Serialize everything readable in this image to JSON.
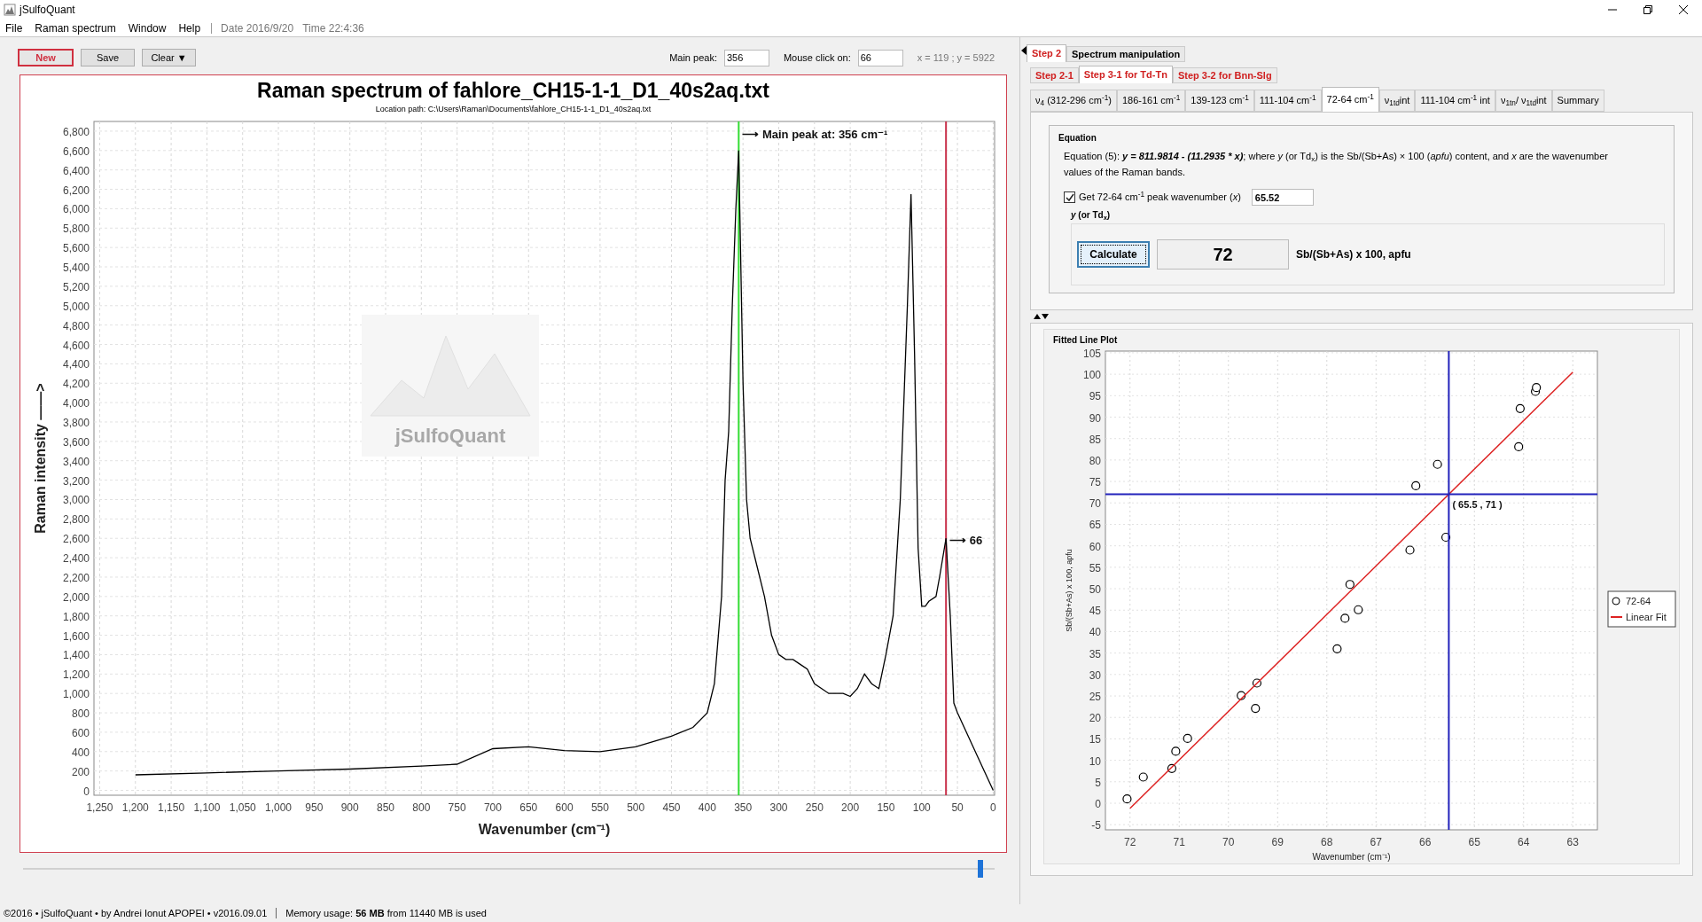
{
  "window": {
    "title": "jSulfoQuant"
  },
  "menu": [
    "File",
    "Raman spectrum",
    "Window",
    "Help"
  ],
  "menu_info": [
    "Date 2016/9/20",
    "Time 22:4:36"
  ],
  "toolbar": {
    "buttons": [
      {
        "label": "New",
        "kind": "primary"
      },
      {
        "label": "Save",
        "kind": "normal"
      },
      {
        "label": "Clear ▼",
        "kind": "normal"
      }
    ],
    "fields": [
      {
        "label": "Main peak:",
        "value": "356"
      },
      {
        "label": "Mouse click on:",
        "value": "66"
      }
    ],
    "coords": "x = 119 ; y = 5922"
  },
  "spectrum": {
    "title": "Raman spectrum of fahlore_CH15-1-1_D1_40s2aq.txt",
    "location": "Location path: C:\\Users\\Raman\\Documents\\fahlore_CH15-1-1_D1_40s2aq.txt",
    "logo_text": "jSulfoQuant",
    "chart_data": {
      "type": "line",
      "xlabel": "Wavenumber (cm⁻¹)",
      "ylabel": "Raman intensity ——>",
      "xlim": [
        1258,
        -2
      ],
      "ylim": [
        -50,
        6900
      ],
      "xticks": [
        {
          "value": 1250,
          "label": "1,250"
        },
        {
          "value": 1200,
          "label": "1,200"
        },
        {
          "value": 1150,
          "label": "1,150"
        },
        {
          "value": 1100,
          "label": "1,100"
        },
        {
          "value": 1050,
          "label": "1,050"
        },
        {
          "value": 1000,
          "label": "1,000"
        },
        950,
        900,
        850,
        800,
        750,
        700,
        650,
        600,
        550,
        500,
        450,
        400,
        350,
        300,
        250,
        200,
        150,
        100,
        50,
        0
      ],
      "yticks": [
        0,
        200,
        400,
        600,
        800,
        {
          "value": 1000,
          "label": "1,000"
        },
        {
          "value": 1200,
          "label": "1,200"
        },
        {
          "value": 1400,
          "label": "1,400"
        },
        {
          "value": 1600,
          "label": "1,600"
        },
        {
          "value": 1800,
          "label": "1,800"
        },
        {
          "value": 2000,
          "label": "2,000"
        },
        {
          "value": 2200,
          "label": "2,200"
        },
        {
          "value": 2400,
          "label": "2,400"
        },
        {
          "value": 2600,
          "label": "2,600"
        },
        {
          "value": 2800,
          "label": "2,800"
        },
        {
          "value": 3000,
          "label": "3,000"
        },
        {
          "value": 3200,
          "label": "3,200"
        },
        {
          "value": 3400,
          "label": "3,400"
        },
        {
          "value": 3600,
          "label": "3,600"
        },
        {
          "value": 3800,
          "label": "3,800"
        },
        {
          "value": 4000,
          "label": "4,000"
        },
        {
          "value": 4200,
          "label": "4,200"
        },
        {
          "value": 4400,
          "label": "4,400"
        },
        {
          "value": 4600,
          "label": "4,600"
        },
        {
          "value": 4800,
          "label": "4,800"
        },
        {
          "value": 5000,
          "label": "5,000"
        },
        {
          "value": 5200,
          "label": "5,200"
        },
        {
          "value": 5400,
          "label": "5,400"
        },
        {
          "value": 5600,
          "label": "5,600"
        },
        {
          "value": 5800,
          "label": "5,800"
        },
        {
          "value": 6000,
          "label": "6,000"
        },
        {
          "value": 6200,
          "label": "6,200"
        },
        {
          "value": 6400,
          "label": "6,400"
        },
        {
          "value": 6600,
          "label": "6,600"
        },
        {
          "value": 6800,
          "label": "6,800"
        }
      ],
      "x": [
        1200,
        1100,
        1000,
        900,
        800,
        750,
        700,
        650,
        600,
        550,
        500,
        450,
        420,
        400,
        390,
        380,
        375,
        370,
        365,
        360,
        356,
        350,
        345,
        340,
        330,
        320,
        310,
        300,
        290,
        280,
        270,
        260,
        250,
        240,
        230,
        220,
        210,
        200,
        190,
        180,
        170,
        160,
        150,
        140,
        130,
        120,
        115,
        110,
        105,
        100,
        95,
        90,
        80,
        75,
        66,
        60,
        55,
        50,
        25,
        0
      ],
      "grid": true,
      "series": [
        {
          "color": "#000000",
          "values": [
            160,
            180,
            200,
            220,
            250,
            270,
            430,
            450,
            410,
            400,
            450,
            560,
            650,
            800,
            1100,
            2000,
            3200,
            3700,
            5000,
            6000,
            6600,
            4200,
            3000,
            2600,
            2300,
            2000,
            1600,
            1400,
            1350,
            1350,
            1300,
            1250,
            1100,
            1050,
            1000,
            1000,
            1000,
            970,
            1050,
            1200,
            1100,
            1050,
            1400,
            1800,
            3000,
            5000,
            6150,
            4500,
            2500,
            1900,
            1900,
            1950,
            2000,
            2200,
            2600,
            1800,
            900,
            800,
            400,
            0
          ]
        }
      ],
      "ref_lines": [
        {
          "axis": "x",
          "value": 356,
          "color": "#33dd33"
        },
        {
          "axis": "x",
          "value": 66,
          "color": "#c8304a"
        }
      ],
      "annotations": [
        "⟶ Main peak at: 356 cm⁻¹",
        "⟶ 66"
      ]
    }
  },
  "slider": {
    "level": 0.985
  },
  "tabs_level1": [
    {
      "label": "Step 2",
      "selected": true
    },
    {
      "label": "Spectrum manipulation",
      "selected": false
    }
  ],
  "tabs_level2": [
    {
      "label": "Step 2-1",
      "selected": false
    },
    {
      "label": "Step 3-1 for Td-Tn",
      "selected": true
    },
    {
      "label": "Step 3-2 for Bnn-Slg",
      "selected": false
    }
  ],
  "tabs_level3": [
    {
      "label": "ν$_{4}$ (312-296 cm$^{-1}$)",
      "selected": false
    },
    {
      "label": "186-161 cm$^{-1}$",
      "selected": false
    },
    {
      "label": "139-123 cm$^{-1}$",
      "selected": false
    },
    {
      "label": "111-104 cm$^{-1}$",
      "selected": false
    },
    {
      "label": "72-64 cm$^{-1}$",
      "selected": true
    },
    {
      "label": "ν$_{1td}$int",
      "selected": false
    },
    {
      "label": "111-104 cm$^{-1}$ int",
      "selected": false
    },
    {
      "label": "ν$_{1tn}$/ ν$_{1td}$int",
      "selected": false
    },
    {
      "label": "Summary",
      "selected": false
    }
  ],
  "equation": {
    "title": "Equation",
    "parts": [
      {
        "text": "Equation (5): ",
        "kind": "plain"
      },
      {
        "text": "y = 811.9814 - (11.2935 * x)",
        "kind": "formula"
      },
      {
        "text": "; where ",
        "kind": "plain"
      },
      {
        "text": "y",
        "kind": "variable"
      },
      {
        "text": " (or Td",
        "kind": "plain"
      },
      {
        "text": "x",
        "kind": "subscript"
      },
      {
        "text": ") is the Sb/(Sb+As) × 100 (",
        "kind": "plain"
      },
      {
        "text": "apfu",
        "kind": "variable"
      },
      {
        "text": ") content, and ",
        "kind": "plain"
      },
      {
        "text": "x",
        "kind": "variable"
      },
      {
        "text": " are the wavenumber values of the Raman bands.",
        "kind": "plain"
      }
    ],
    "checkbox": {
      "label": "Get 72-64 cm$^{-1}$ peak wavenumber (*x*)",
      "checked": true
    },
    "x_value": "65.52",
    "result_group": "*y* (or Td$_{x}$)",
    "button": "Calculate",
    "result": "72",
    "unit": "Sb/(Sb+As) x 100, apfu"
  },
  "fitted_plot": {
    "title": "Fitted Line Plot",
    "chart_data": {
      "type": "scatter",
      "xlabel": "Wavenumber (cm⁻¹)",
      "ylabel": "Sb/(Sb+As) x 100, apfu",
      "xlim": [
        72.5,
        62.5
      ],
      "ylim": [
        -6.2,
        105.4
      ],
      "xticks": [
        72,
        71,
        70,
        69,
        68,
        67,
        66,
        65,
        64,
        63
      ],
      "yticks": [
        -5,
        0,
        5,
        10,
        15,
        20,
        25,
        30,
        35,
        40,
        45,
        50,
        55,
        60,
        65,
        70,
        75,
        80,
        85,
        90,
        95,
        100,
        105
      ],
      "grid": true,
      "series": [
        {
          "name": "72-64",
          "type": "scatter",
          "color": "#000000",
          "x": [
            72.06,
            71.73,
            71.15,
            71.07,
            70.83,
            69.74,
            69.42,
            69.45,
            67.79,
            67.63,
            67.53,
            67.36,
            66.31,
            66.19,
            65.75,
            65.58,
            64.1,
            64.07,
            63.76,
            63.74
          ],
          "values": [
            1,
            6.1,
            8.1,
            12.1,
            15.1,
            25.1,
            28,
            22.1,
            36,
            43.1,
            51,
            45.1,
            59,
            74,
            79,
            62,
            83.1,
            92,
            96,
            96.9
          ]
        },
        {
          "name": "Linear Fit",
          "type": "line",
          "color": "#dd2222",
          "x": [
            72,
            63
          ],
          "values": [
            -1.2,
            100.5
          ]
        }
      ],
      "legend": "right",
      "ref_lines": [
        {
          "axis": "x",
          "value": 65.52,
          "color": "#2222bb"
        },
        {
          "axis": "y",
          "value": 72,
          "color": "#2222bb"
        }
      ],
      "annotations": [
        "( 65.5 , 71 )"
      ]
    }
  },
  "status": [
    "©2016 • jSulfoQuant • by Andrei Ionut APOPEI • v2016.09.01",
    "Memory usage: **56 MB** from 11440 MB is used"
  ]
}
